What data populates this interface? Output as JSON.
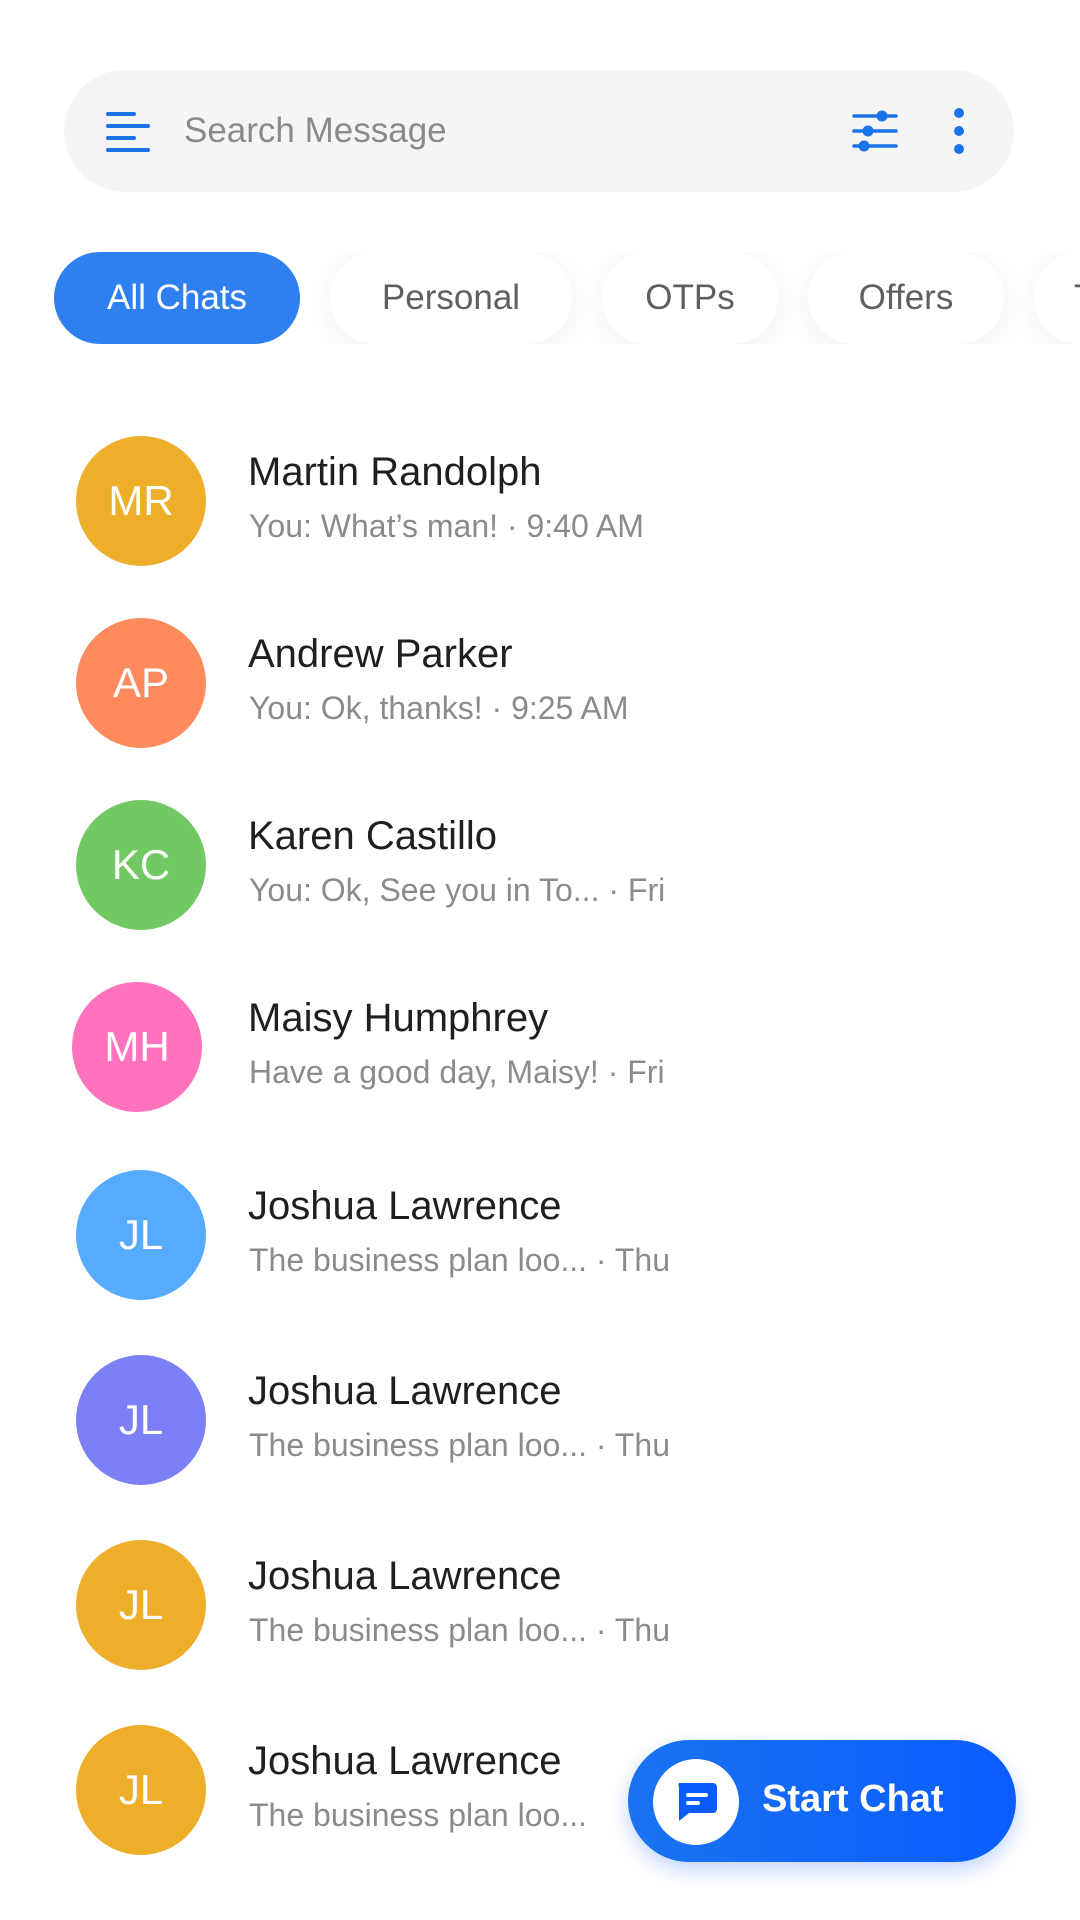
{
  "search": {
    "placeholder": "Search Message",
    "menu_icon": "menu-icon",
    "filter_icon": "sliders-icon",
    "more_icon": "more-vertical-icon"
  },
  "tabs": [
    {
      "label": "All Chats",
      "active": true
    },
    {
      "label": "Personal",
      "active": false
    },
    {
      "label": "OTPs",
      "active": false
    },
    {
      "label": "Offers",
      "active": false
    },
    {
      "label": "T",
      "active": false
    }
  ],
  "chats": [
    {
      "initials": "MR",
      "name": "Martin Randolph",
      "preview": "You: What’s man! · 9:40 AM",
      "color": "#EDAE2A"
    },
    {
      "initials": "AP",
      "name": "Andrew Parker",
      "preview": "You: Ok, thanks! · 9:25 AM",
      "color": "#FF8A5E"
    },
    {
      "initials": "KC",
      "name": "Karen Castillo",
      "preview": "You: Ok, See you in To... · Fri",
      "color": "#72C963"
    },
    {
      "initials": "MH",
      "name": "Maisy Humphrey",
      "preview": "Have a good day, Maisy! · Fri",
      "color": "#FF72BD"
    },
    {
      "initials": "JL",
      "name": "Joshua Lawrence",
      "preview": "The business plan loo...  · Thu",
      "color": "#56ABFF"
    },
    {
      "initials": "JL",
      "name": "Joshua Lawrence",
      "preview": "The business plan loo...  · Thu",
      "color": "#7D7FF7"
    },
    {
      "initials": "JL",
      "name": "Joshua Lawrence",
      "preview": "The business plan loo...  · Thu",
      "color": "#EDAE2A"
    },
    {
      "initials": "JL",
      "name": "Joshua Lawrence",
      "preview": "The business plan loo...",
      "color": "#EDAE2A"
    }
  ],
  "fab": {
    "label": "Start Chat",
    "icon": "chat-bubble-icon"
  },
  "colors": {
    "accent": "#2E7FF0",
    "fab": "#0A5CFF"
  }
}
